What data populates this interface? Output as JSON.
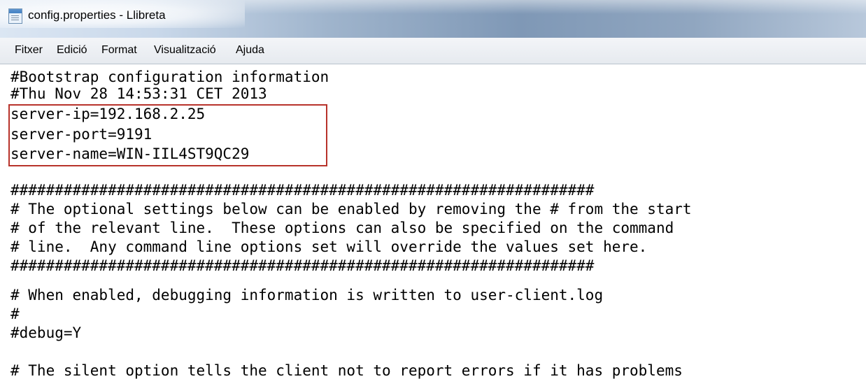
{
  "window": {
    "title": "config.properties - Llibreta"
  },
  "menu": {
    "items": [
      "Fitxer",
      "Edició",
      "Format",
      "Visualització",
      "Ajuda"
    ]
  },
  "editor": {
    "lines": [
      "#Bootstrap configuration information",
      "#Thu Nov 28 14:53:31 CET 2013",
      "server-ip=192.168.2.25",
      "server-port=9191",
      "server-name=WIN-IIL4ST9QC29",
      "",
      "##################################################################",
      "# The optional settings below can be enabled by removing the # from the start",
      "# of the relevant line.  These options can also be specified on the command",
      "# line.  Any command line options set will override the values set here.",
      "##################################################################",
      "",
      "# When enabled, debugging information is written to user-client.log",
      "#",
      "#debug=Y",
      "",
      "# The silent option tells the client not to report errors if it has problems"
    ]
  },
  "colors": {
    "highlight_border": "#b8332b"
  }
}
